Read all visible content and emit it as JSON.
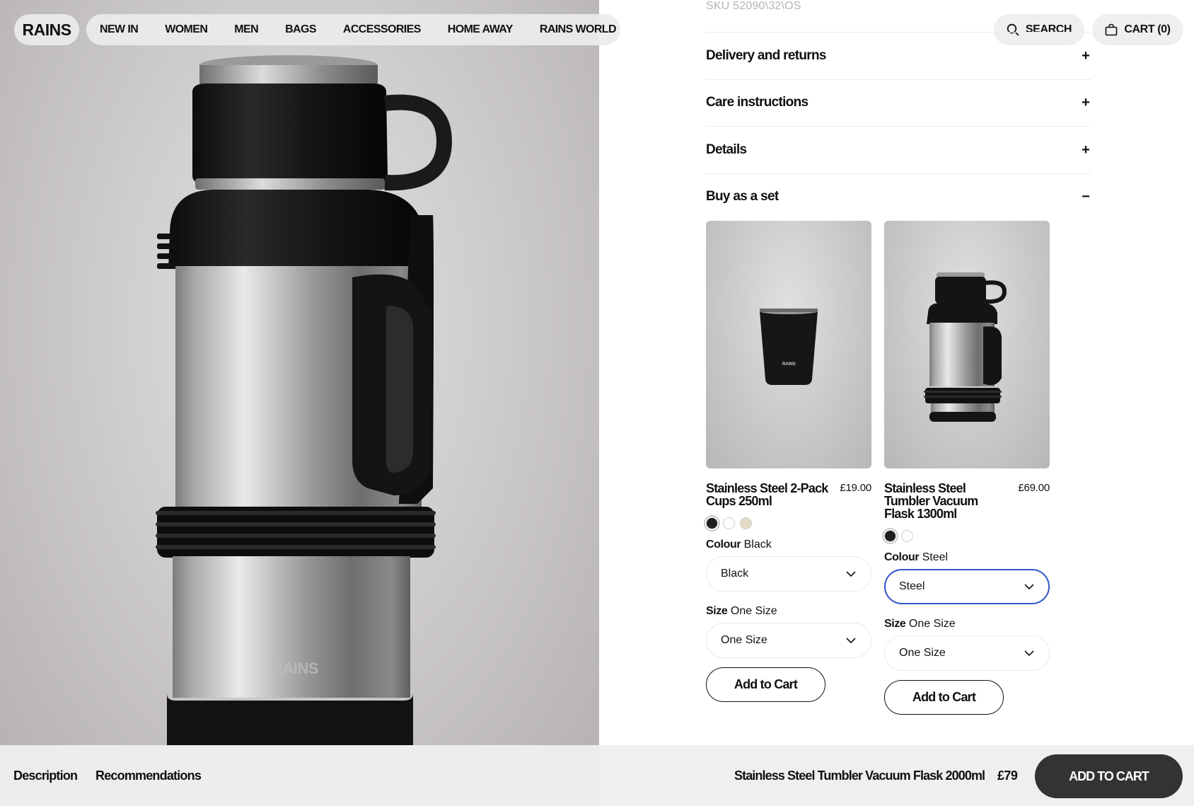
{
  "brand": {
    "logo_text": "RAINS"
  },
  "nav": {
    "items": [
      "NEW IN",
      "WOMEN",
      "MEN",
      "BAGS",
      "ACCESSORIES",
      "HOME AWAY",
      "RAINS WORLD"
    ],
    "search_label": "SEARCH",
    "cart_label": "CART (0)",
    "search_icon": "search-icon",
    "cart_icon": "bag-icon"
  },
  "hero": {
    "embossed_logo": "RAINS"
  },
  "product": {
    "sku": "SKU 52090\\32\\OS"
  },
  "accordion": [
    {
      "title": "Delivery and returns",
      "sign": "+"
    },
    {
      "title": "Care instructions",
      "sign": "+"
    },
    {
      "title": "Details",
      "sign": "+"
    },
    {
      "title": "Buy as a set",
      "sign": "−"
    }
  ],
  "set_products": [
    {
      "name": "Stainless Steel 2-Pack Cups 250ml",
      "price": "£19.00",
      "thumb_logo": "RAINS",
      "swatches": [
        "#1f1f1f",
        "#ffffff",
        "#e4dac8"
      ],
      "selected_swatch": 0,
      "colour_label": "Colour",
      "colour_value": "Black",
      "colour_select": "Black",
      "size_label": "Size",
      "size_value": "One Size",
      "size_select": "One Size",
      "add_label": "Add to Cart"
    },
    {
      "name": "Stainless Steel Tumbler Vacuum Flask 1300ml",
      "price": "£69.00",
      "swatches": [
        "#1f1f1f",
        "#ffffff"
      ],
      "selected_swatch": 0,
      "colour_label": "Colour",
      "colour_value": "Steel",
      "colour_select": "Steel",
      "size_label": "Size",
      "size_value": "One Size",
      "size_select": "One Size",
      "add_label": "Add to Cart"
    }
  ],
  "bottom_bar": {
    "tabs": [
      "Description",
      "Recommendations"
    ],
    "product_name": "Stainless Steel Tumbler Vacuum Flask 2000ml",
    "price": "£79",
    "cta_label": "ADD TO CART"
  },
  "colors": {
    "focus_ring": "#2f56c9",
    "cta_bg": "#333333",
    "muted_text": "#b5b5b5"
  }
}
